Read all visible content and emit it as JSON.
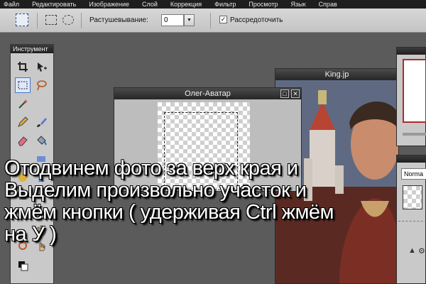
{
  "menu": [
    "Файл",
    "Редактировать",
    "Изображение",
    "Слой",
    "Коррекция",
    "Фильтр",
    "Просмотр",
    "Язык",
    "Справ"
  ],
  "options": {
    "feather_label": "Растушевывание:",
    "feather_value": "0",
    "antialias_label": "Рассредоточить",
    "antialias_checked": "✓"
  },
  "tools": {
    "title": "Инструмент"
  },
  "documents": {
    "avatar": {
      "title": "Олег-Аватар"
    },
    "king": {
      "title": "King.jp"
    }
  },
  "layers": {
    "blend_mode": "Norma"
  },
  "caption": "Отодвинем фото за верх края и\nВыделим произвольно участок и\nжмём кнопки ( удерживая Ctrl жмём\nна  У )",
  "colors": {
    "menubar": "#1e1e1e",
    "workspace": "#5b5b5b",
    "selection": "#2a4f8e"
  }
}
